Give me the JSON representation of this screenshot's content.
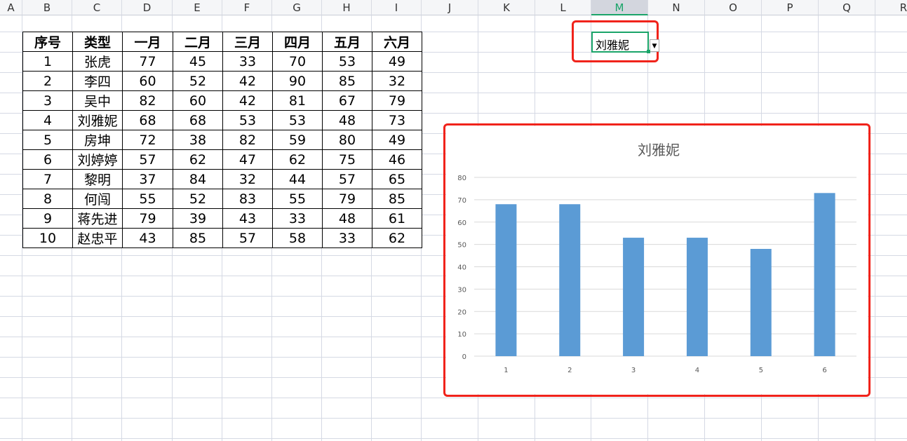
{
  "columns": [
    "A",
    "B",
    "C",
    "D",
    "E",
    "F",
    "G",
    "H",
    "I",
    "J",
    "K",
    "L",
    "M",
    "N",
    "O",
    "P",
    "Q",
    "R"
  ],
  "selected_column": "M",
  "table": {
    "headers": [
      "序号",
      "类型",
      "一月",
      "二月",
      "三月",
      "四月",
      "五月",
      "六月"
    ],
    "rows": [
      [
        "1",
        "张虎",
        "77",
        "45",
        "33",
        "70",
        "53",
        "49"
      ],
      [
        "2",
        "李四",
        "60",
        "52",
        "42",
        "90",
        "85",
        "32"
      ],
      [
        "3",
        "吴中",
        "82",
        "60",
        "42",
        "81",
        "67",
        "79"
      ],
      [
        "4",
        "刘雅妮",
        "68",
        "68",
        "53",
        "53",
        "48",
        "73"
      ],
      [
        "5",
        "房坤",
        "72",
        "38",
        "82",
        "59",
        "80",
        "49"
      ],
      [
        "6",
        "刘婷婷",
        "57",
        "62",
        "47",
        "62",
        "75",
        "46"
      ],
      [
        "7",
        "黎明",
        "37",
        "84",
        "32",
        "44",
        "57",
        "65"
      ],
      [
        "8",
        "何闯",
        "55",
        "52",
        "83",
        "55",
        "79",
        "85"
      ],
      [
        "9",
        "蒋先进",
        "79",
        "39",
        "43",
        "33",
        "48",
        "61"
      ],
      [
        "10",
        "赵忠平",
        "43",
        "85",
        "57",
        "58",
        "33",
        "62"
      ]
    ]
  },
  "dropdown_cell": {
    "value": "刘雅妮",
    "icon": "dropdown-arrow-icon"
  },
  "colors": {
    "bar": "#5b9bd5",
    "highlight": "#f0231b",
    "selection": "#1aa469"
  },
  "chart_data": {
    "type": "bar",
    "title": "刘雅妮",
    "categories": [
      "1",
      "2",
      "3",
      "4",
      "5",
      "6"
    ],
    "values": [
      68,
      68,
      53,
      53,
      48,
      73
    ],
    "yticks": [
      "0",
      "10",
      "20",
      "30",
      "40",
      "50",
      "60",
      "70",
      "80"
    ],
    "ylim": [
      0,
      80
    ],
    "xlabel": "",
    "ylabel": "",
    "grid": true,
    "legend": "none"
  }
}
